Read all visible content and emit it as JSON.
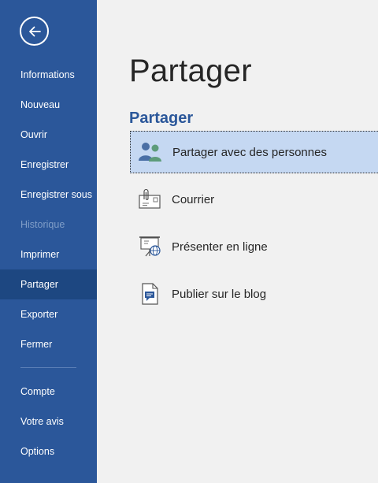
{
  "sidebar": {
    "back_icon": "back-arrow-icon",
    "items": [
      {
        "label": "Informations",
        "state": "normal"
      },
      {
        "label": "Nouveau",
        "state": "normal"
      },
      {
        "label": "Ouvrir",
        "state": "normal"
      },
      {
        "label": "Enregistrer",
        "state": "normal"
      },
      {
        "label": "Enregistrer sous",
        "state": "normal"
      },
      {
        "label": "Historique",
        "state": "disabled"
      },
      {
        "label": "Imprimer",
        "state": "normal"
      },
      {
        "label": "Partager",
        "state": "active"
      },
      {
        "label": "Exporter",
        "state": "normal"
      },
      {
        "label": "Fermer",
        "state": "normal"
      }
    ],
    "bottom_items": [
      {
        "label": "Compte"
      },
      {
        "label": "Votre avis"
      },
      {
        "label": "Options"
      }
    ]
  },
  "main": {
    "title": "Partager",
    "section_title": "Partager",
    "options": [
      {
        "label": "Partager avec des personnes",
        "icon": "people-icon",
        "selected": true
      },
      {
        "label": "Courrier",
        "icon": "mail-attachment-icon",
        "selected": false
      },
      {
        "label": "Présenter en ligne",
        "icon": "present-online-icon",
        "selected": false
      },
      {
        "label": "Publier sur le blog",
        "icon": "blog-post-icon",
        "selected": false
      }
    ]
  },
  "colors": {
    "sidebar": "#2b579a",
    "sidebar_active": "#1d4781",
    "accent": "#2b579a",
    "selected_bg": "#c5d8f2",
    "background": "#f1f1f1"
  }
}
